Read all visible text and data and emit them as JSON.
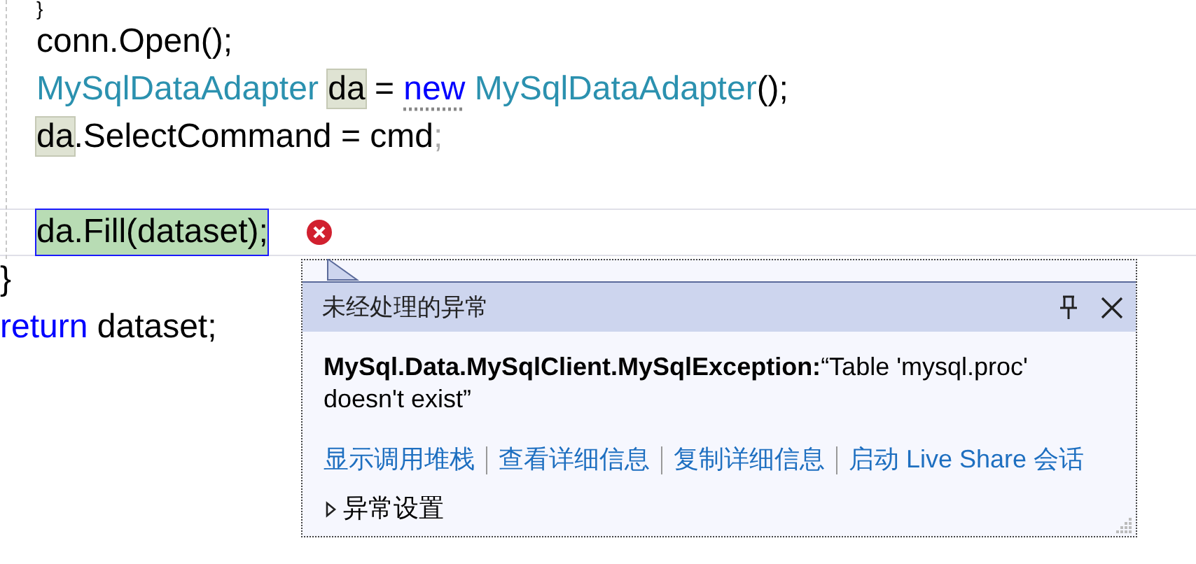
{
  "code": {
    "nested_lines": [
      {
        "selected": false,
        "tokens": [
          {
            "text": "}",
            "kind": "plain",
            "highlighted": false
          }
        ]
      },
      {
        "selected": false,
        "tokens": [
          {
            "text": "conn.Open();",
            "kind": "plain",
            "highlighted": false
          }
        ]
      },
      {
        "selected": false,
        "tokens": [
          {
            "text": "MySqlDataAdapter ",
            "kind": "type",
            "highlighted": false
          },
          {
            "text": "da",
            "kind": "plain",
            "highlighted": true
          },
          {
            "text": " = ",
            "kind": "plain",
            "highlighted": false
          },
          {
            "text": "new",
            "kind": "keyword_hint",
            "highlighted": false
          },
          {
            "text": " MySqlDataAdapter",
            "kind": "type",
            "highlighted": false
          },
          {
            "text": "();",
            "kind": "plain",
            "highlighted": false
          }
        ]
      },
      {
        "selected": false,
        "tokens": [
          {
            "text": "da",
            "kind": "plain",
            "highlighted": true
          },
          {
            "text": ".SelectCommand = cmd",
            "kind": "plain",
            "highlighted": false
          },
          {
            "text": ";",
            "kind": "faded",
            "highlighted": false
          }
        ]
      },
      {
        "selected": false
      },
      {
        "selected": true,
        "error": true,
        "tokens": [
          {
            "text": "da.Fill(dataset);",
            "kind": "plain",
            "highlighted": false
          }
        ]
      }
    ],
    "lines": [
      {
        "tokens": [
          {
            "text": "}",
            "kind": "plain",
            "highlighted": false
          }
        ]
      },
      {
        "tokens": [
          {
            "text": "return",
            "kind": "keyword",
            "highlighted": false
          },
          {
            "text": " dataset;",
            "kind": "plain",
            "highlighted": false
          }
        ]
      }
    ]
  },
  "exception_popup": {
    "title": "未经处理的异常",
    "message": "**MySql.Data.MySqlClient.MySqlException:**“Table 'mysql.proc' doesn't exist”",
    "links": [
      "显示调用堆栈",
      "查看详细信息",
      "复制详细信息",
      "启动 Live Share 会话"
    ],
    "exception_settings": {
      "label": "异常设置",
      "expanded": false
    }
  }
}
